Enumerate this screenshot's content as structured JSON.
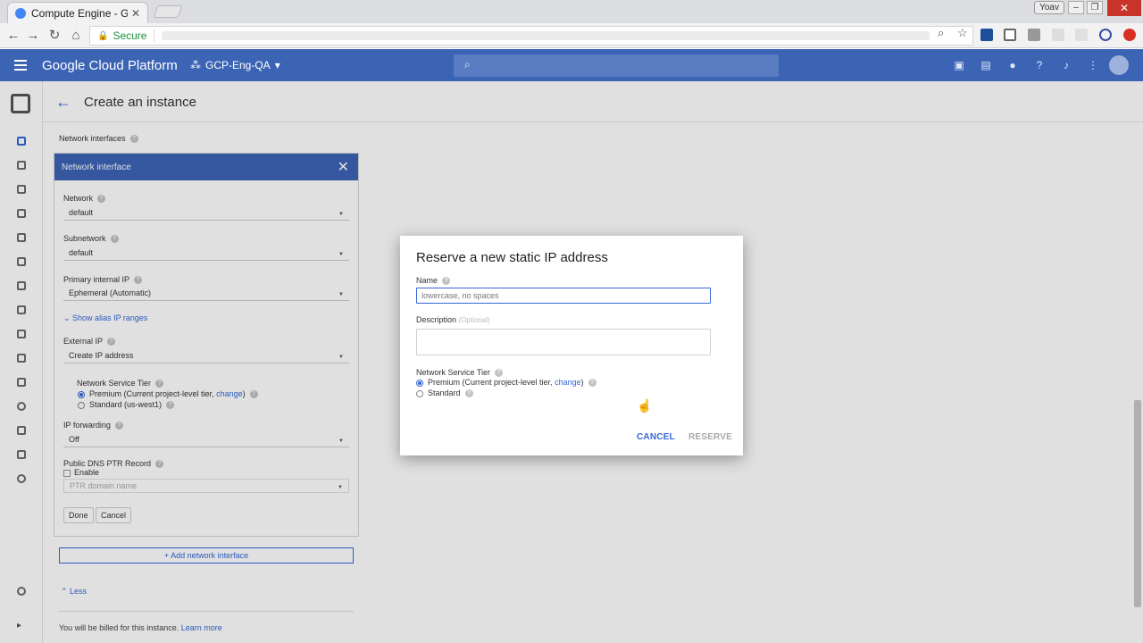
{
  "browser": {
    "tab_title": "Compute Engine - GCP-E",
    "secure_label": "Secure",
    "user_label": "Yoav"
  },
  "header": {
    "brand": "Google Cloud Platform",
    "project": "GCP-Eng-QA"
  },
  "page": {
    "title": "Create an instance",
    "section_label": "Network interfaces"
  },
  "network_interface": {
    "header": "Network interface",
    "network_label": "Network",
    "network_value": "default",
    "subnetwork_label": "Subnetwork",
    "subnetwork_value": "default",
    "primary_ip_label": "Primary internal IP",
    "primary_ip_value": "Ephemeral (Automatic)",
    "alias_link": "Show alias IP ranges",
    "external_ip_label": "External IP",
    "external_ip_value": "Create IP address",
    "tier_label": "Network Service Tier",
    "tier_premium": "Premium (Current project-level tier,",
    "tier_change": "change",
    "tier_close": ")",
    "tier_standard": "Standard (us-west1)",
    "ip_forwarding_label": "IP forwarding",
    "ip_forwarding_value": "Off",
    "dns_label": "Public DNS PTR Record",
    "dns_enable": "Enable",
    "dns_placeholder": "PTR domain name",
    "done": "Done",
    "cancel": "Cancel"
  },
  "add_interface": "Add network interface",
  "less_link": "Less",
  "billing": {
    "text": "You will be billed for this instance.",
    "link": "Learn more"
  },
  "dialog": {
    "title": "Reserve a new static IP address",
    "name_label": "Name",
    "name_placeholder": "lowercase, no spaces",
    "desc_label": "Description",
    "desc_optional": "(Optional)",
    "tier_label": "Network Service Tier",
    "premium": "Premium (Current project-level tier,",
    "change": "change",
    "premium_close": ")",
    "standard": "Standard",
    "cancel": "CANCEL",
    "reserve": "RESERVE"
  },
  "colors": {
    "primary_blue": "#3c64b5",
    "link_blue": "#3367d6"
  }
}
